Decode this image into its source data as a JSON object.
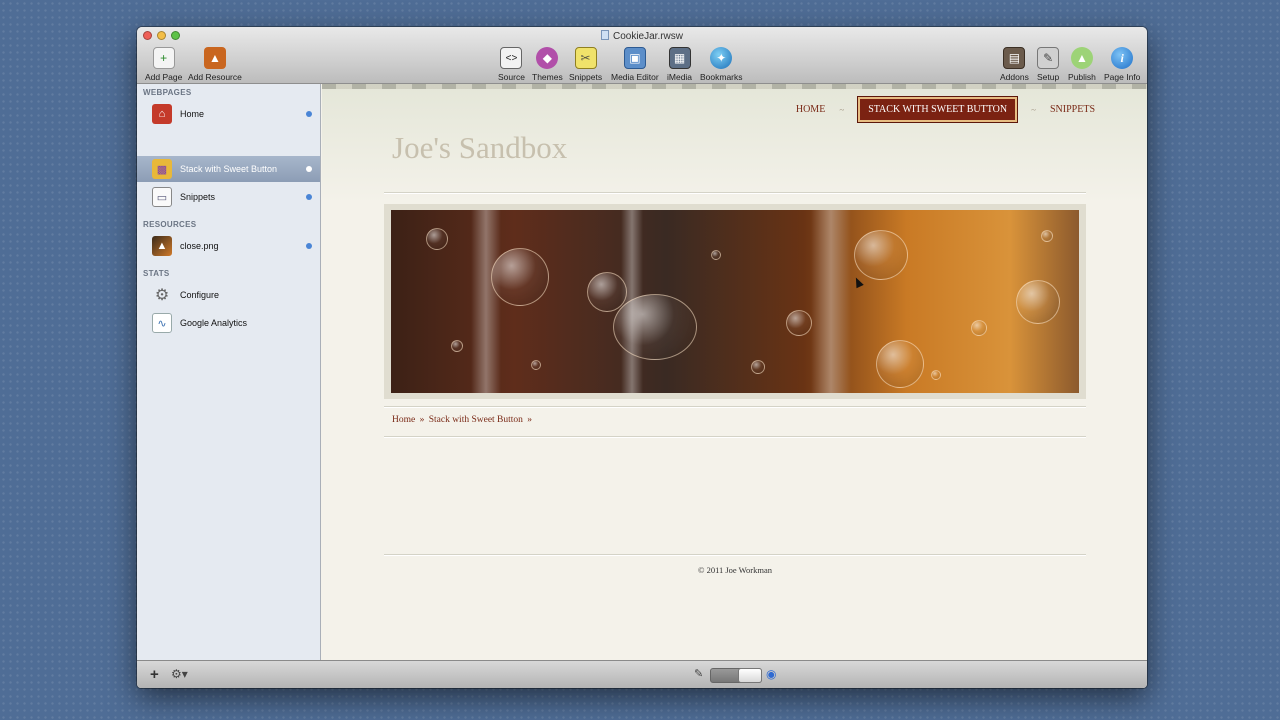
{
  "window": {
    "title": "CookieJar.rwsw"
  },
  "toolbar": {
    "left": [
      {
        "label": "Add Page",
        "icon": "add-page-icon"
      },
      {
        "label": "Add Resource",
        "icon": "add-resource-icon"
      }
    ],
    "center": [
      {
        "label": "Source",
        "icon": "source-icon"
      },
      {
        "label": "Themes",
        "icon": "themes-icon"
      },
      {
        "label": "Snippets",
        "icon": "snippets-icon"
      },
      {
        "label": "Media Editor",
        "icon": "media-editor-icon"
      },
      {
        "label": "iMedia",
        "icon": "imedia-icon"
      },
      {
        "label": "Bookmarks",
        "icon": "bookmarks-icon"
      }
    ],
    "right": [
      {
        "label": "Addons",
        "icon": "addons-icon"
      },
      {
        "label": "Setup",
        "icon": "setup-icon"
      },
      {
        "label": "Publish",
        "icon": "publish-icon"
      },
      {
        "label": "Page Info",
        "icon": "page-info-icon"
      }
    ]
  },
  "sidebar": {
    "sections": [
      {
        "title": "WEBPAGES",
        "items": [
          {
            "label": "Home",
            "icon": "house-icon",
            "dot": true
          },
          {
            "label": "Stack with Sweet Button",
            "icon": "stacks-icon",
            "dot": true,
            "selected": true
          },
          {
            "label": "Snippets",
            "icon": "page-icon",
            "dot": true
          }
        ]
      },
      {
        "title": "RESOURCES",
        "items": [
          {
            "label": "close.png",
            "icon": "image-icon",
            "dot": true
          }
        ]
      },
      {
        "title": "STATS",
        "items": [
          {
            "label": "Configure",
            "icon": "gear-icon"
          },
          {
            "label": "Google Analytics",
            "icon": "chart-icon"
          }
        ]
      }
    ]
  },
  "site": {
    "nav": [
      "HOME",
      "STACK WITH SWEET BUTTON",
      "SNIPPETS"
    ],
    "nav_active": 1,
    "nav_separator": "~",
    "title": "Joe's Sandbox",
    "breadcrumb": [
      "Home",
      "Stack with Sweet Button"
    ],
    "breadcrumb_separator": "»",
    "footer": "© 2011 Joe Workman"
  },
  "bottombar": {
    "add_icon": "plus-icon",
    "gear_icon": "gear-menu-icon",
    "edit_icon": "pencil-icon",
    "preview_icon": "eye-icon"
  },
  "colors": {
    "accent": "#7b2212",
    "link": "#7a2a17",
    "sidebar_bg": "#e5eaf1",
    "selected_row": "#8c9db5"
  }
}
